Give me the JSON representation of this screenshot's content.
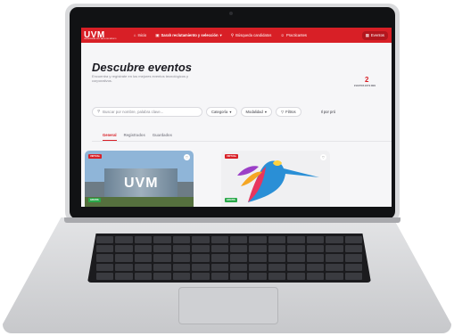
{
  "nav": {
    "logo": "UVM",
    "logo_sub": "UNIVERSIDAD DEL VALLE DE MÉXICO",
    "items": [
      {
        "label": "Inicio",
        "icon": "home-icon"
      },
      {
        "label": "Sarah reclutamiento y selección",
        "icon": "building-icon"
      },
      {
        "label": "Búsqueda candidatos",
        "icon": "user-search-icon"
      },
      {
        "label": "Practicantes",
        "icon": "users-icon"
      },
      {
        "label": "Eventos",
        "icon": "calendar-icon"
      }
    ],
    "accent": "#d81f26"
  },
  "page": {
    "title": "Descubre eventos",
    "subtitle": "Encuentra y regístrate en los mejores eventos tecnológicos y corporativos.",
    "count": "2",
    "count_label": "EVENTOS ESTE MES"
  },
  "toolbar": {
    "search_placeholder": "Buscar por nombre, palabra clave...",
    "category": "Categoría",
    "modality": "Modalidad",
    "filters": "Filtros",
    "sort": "Il por pró"
  },
  "tabs": [
    "General",
    "Registrados",
    "Guardados"
  ],
  "cards": [
    {
      "badge": "VIRTUAL",
      "tag": "GRATIS",
      "image_text": "UVM"
    },
    {
      "badge": "VIRTUAL",
      "tag": "GRATIS"
    }
  ]
}
